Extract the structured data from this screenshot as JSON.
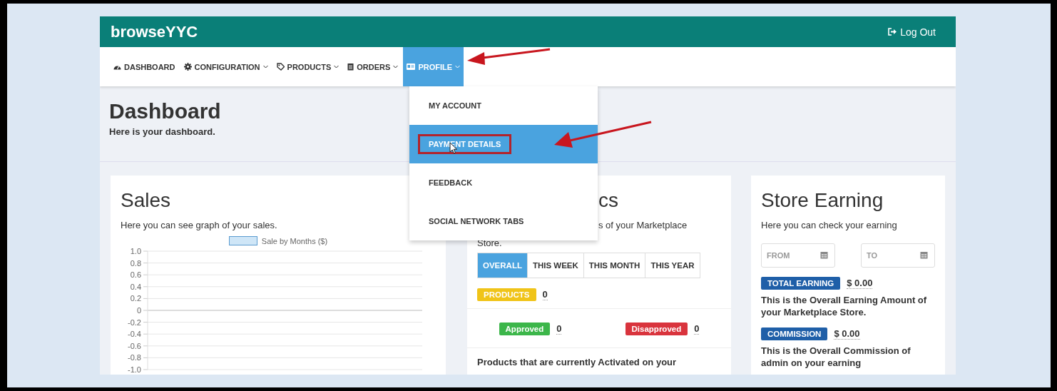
{
  "header": {
    "brand": "browseYYC",
    "logout": "Log Out"
  },
  "nav": [
    {
      "label": "DASHBOARD",
      "dropdown": false,
      "selected": false,
      "arrow": false
    },
    {
      "label": "CONFIGURATION",
      "dropdown": true,
      "selected": false,
      "arrow": false
    },
    {
      "label": "PRODUCTS",
      "dropdown": true,
      "selected": false,
      "arrow": false
    },
    {
      "label": "ORDERS",
      "dropdown": true,
      "selected": false,
      "arrow": false
    },
    {
      "label": "PROFILE",
      "dropdown": true,
      "selected": true,
      "arrow": true
    }
  ],
  "profile_menu": {
    "items": [
      {
        "label": "MY ACCOUNT",
        "selected": false,
        "outlined": false,
        "arrow": false
      },
      {
        "label": "PAYMENT DETAILS",
        "selected": true,
        "outlined": true,
        "arrow": true
      },
      {
        "label": "FEEDBACK",
        "selected": false,
        "outlined": false,
        "arrow": false
      },
      {
        "label": "SOCIAL NETWORK TABS",
        "selected": false,
        "outlined": false,
        "arrow": false
      }
    ]
  },
  "page": {
    "title": "Dashboard",
    "subtitle": "Here is your dashboard."
  },
  "sales": {
    "title": "Sales",
    "description": "Here you can see graph of your sales.",
    "chart_data": {
      "type": "bar",
      "grid": true,
      "series": [
        {
          "name": "Sale by Months ($)",
          "color": "#cfe6f7"
        }
      ],
      "ylim": [
        -1,
        1
      ],
      "yticks": [
        {
          "value": 1,
          "label": "1.0"
        },
        {
          "value": 0.8,
          "label": "0.8"
        },
        {
          "value": 0.6,
          "label": "0.6"
        },
        {
          "value": 0.4,
          "label": "0.4"
        },
        {
          "value": 0.2,
          "label": "0.2"
        },
        {
          "value": 0,
          "label": "0"
        },
        {
          "value": -0.2,
          "label": "-0.2"
        },
        {
          "value": -0.4,
          "label": "-0.4"
        },
        {
          "value": -0.6,
          "label": "-0.6"
        },
        {
          "value": -0.8,
          "label": "-0.8"
        },
        {
          "value": -1,
          "label": "-1.0"
        }
      ]
    }
  },
  "statistics": {
    "title": "cs",
    "description": "s of your Marketplace",
    "description_continued": "Store.",
    "period_tabs": [
      {
        "label": "OVERALL",
        "selected": true
      },
      {
        "label": "THIS WEEK",
        "selected": false
      },
      {
        "label": "THIS MONTH",
        "selected": false
      },
      {
        "label": "THIS YEAR",
        "selected": false
      }
    ],
    "products": {
      "label": "PRODUCTS",
      "value": "0",
      "kind": "warning"
    },
    "status_counts": [
      {
        "label": "Approved",
        "value": "0",
        "kind": "success"
      },
      {
        "label": "Disapproved",
        "value": "0",
        "kind": "danger"
      }
    ],
    "note": "Products that are currently Activated on your"
  },
  "store_earning": {
    "title": "Store Earning",
    "description": "Here you can check your earning",
    "date_fields": [
      {
        "placeholder": "FROM"
      },
      {
        "placeholder": "TO"
      }
    ],
    "amounts": [
      {
        "label": "TOTAL EARNING",
        "value": "$ 0.00",
        "description": "This is the Overall Earning Amount of your Marketplace Store."
      },
      {
        "label": "COMMISSION",
        "value": "$ 0.00",
        "description": "This is the Overall Commission of admin on your earning"
      }
    ]
  }
}
